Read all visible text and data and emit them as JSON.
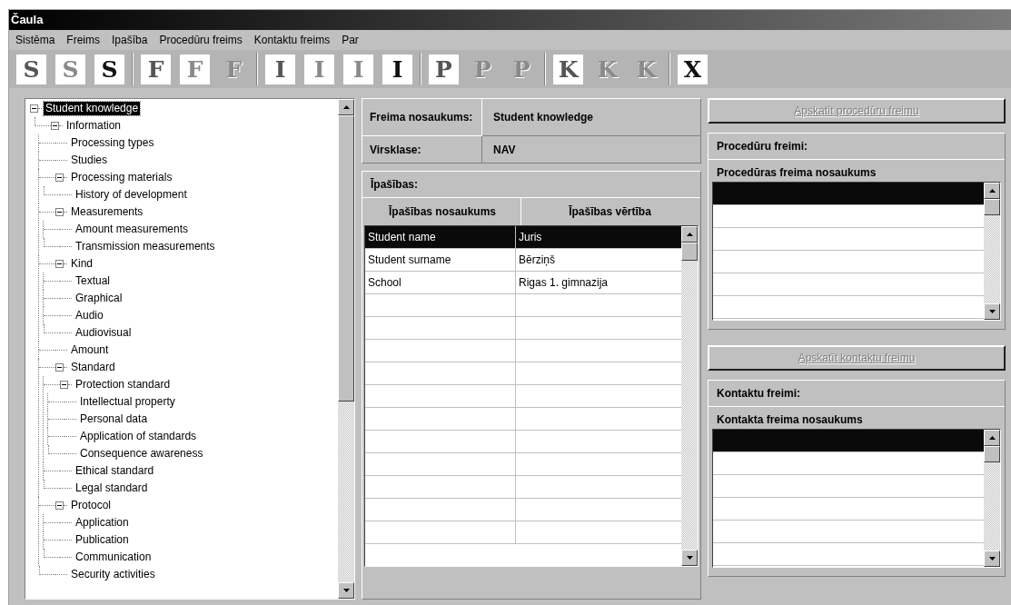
{
  "window": {
    "title": "Čaula"
  },
  "menu": [
    "Sistēma",
    "Freims",
    "Ipašība",
    "Procedūru freims",
    "Kontaktu freims",
    "Par"
  ],
  "toolbar": [
    [
      {
        "letter": "S",
        "kind": "dark"
      },
      {
        "letter": "S",
        "kind": "light"
      },
      {
        "letter": "S",
        "kind": "black"
      }
    ],
    [
      {
        "letter": "F",
        "kind": "dark"
      },
      {
        "letter": "F",
        "kind": "light"
      },
      {
        "letter": "F",
        "kind": "disabled"
      }
    ],
    [
      {
        "letter": "I",
        "kind": "dark"
      },
      {
        "letter": "I",
        "kind": "light"
      },
      {
        "letter": "I",
        "kind": "light"
      },
      {
        "letter": "I",
        "kind": "black"
      }
    ],
    [
      {
        "letter": "P",
        "kind": "dark"
      },
      {
        "letter": "P",
        "kind": "disabled"
      },
      {
        "letter": "P",
        "kind": "disabled"
      }
    ],
    [
      {
        "letter": "K",
        "kind": "dark"
      },
      {
        "letter": "K",
        "kind": "disabled"
      },
      {
        "letter": "K",
        "kind": "disabled"
      }
    ],
    [
      {
        "letter": "X",
        "kind": "black"
      }
    ]
  ],
  "tree": [
    {
      "label": "Student knowledge",
      "selected": true,
      "expanded": true,
      "children": [
        {
          "label": "Information",
          "selected": false,
          "expanded": true,
          "children": [
            {
              "label": "Processing types",
              "selected": false
            },
            {
              "label": "Studies",
              "selected": false
            },
            {
              "label": "Processing materials",
              "selected": false,
              "expanded": true,
              "children": [
                {
                  "label": "History of development",
                  "selected": false
                }
              ]
            },
            {
              "label": "Measurements",
              "selected": false,
              "expanded": true,
              "children": [
                {
                  "label": "Amount measurements",
                  "selected": false
                },
                {
                  "label": "Transmission measurements",
                  "selected": false
                }
              ]
            },
            {
              "label": "Kind",
              "selected": false,
              "expanded": true,
              "children": [
                {
                  "label": "Textual",
                  "selected": false
                },
                {
                  "label": "Graphical",
                  "selected": false
                },
                {
                  "label": "Audio",
                  "selected": false
                },
                {
                  "label": "Audiovisual",
                  "selected": false
                }
              ]
            },
            {
              "label": "Amount",
              "selected": false
            },
            {
              "label": "Standard",
              "selected": false,
              "expanded": true,
              "children": [
                {
                  "label": "Protection standard",
                  "selected": false,
                  "expanded": true,
                  "children": [
                    {
                      "label": "Intellectual property",
                      "selected": false
                    },
                    {
                      "label": "Personal data",
                      "selected": false
                    },
                    {
                      "label": "Application of standards",
                      "selected": false
                    },
                    {
                      "label": "Consequence awareness",
                      "selected": false
                    }
                  ]
                },
                {
                  "label": "Ethical standard",
                  "selected": false
                },
                {
                  "label": "Legal standard",
                  "selected": false
                }
              ]
            },
            {
              "label": "Protocol",
              "selected": false,
              "expanded": true,
              "children": [
                {
                  "label": "Application",
                  "selected": false
                },
                {
                  "label": "Publication",
                  "selected": false
                },
                {
                  "label": "Communication",
                  "selected": false
                }
              ]
            },
            {
              "label": "Security activities",
              "selected": false
            }
          ]
        }
      ]
    }
  ],
  "frame": {
    "name_label": "Freima nosaukums:",
    "name_value": "Student knowledge",
    "superclass_label": "Virsklase:",
    "superclass_value": "NAV"
  },
  "properties": {
    "title": "Īpašības:",
    "columns": [
      "Īpašības nosaukums",
      "Īpašības vērtība"
    ],
    "rows": [
      {
        "name": "Student name",
        "value": "Juris",
        "selected": true
      },
      {
        "name": "Student surname",
        "value": "Bērziņš",
        "selected": false
      },
      {
        "name": "School",
        "value": "Rigas 1. gimnazija",
        "selected": false
      }
    ]
  },
  "procedure_button": {
    "label": "Apskatīt procedūru freimu",
    "disabled": true
  },
  "procedure_frames": {
    "title": "Procedūru freimi:",
    "column": "Procedūras freima nosaukums",
    "rows": [
      {
        "selected": true
      },
      {
        "selected": false
      },
      {
        "selected": false
      },
      {
        "selected": false
      },
      {
        "selected": false
      },
      {
        "selected": false
      }
    ]
  },
  "contact_button": {
    "label": "Apskatīt kontaktu freimu",
    "disabled": true
  },
  "contact_frames": {
    "title": "Kontaktu freimi:",
    "column": "Kontakta freima nosaukums",
    "rows": [
      {
        "selected": true
      },
      {
        "selected": false
      },
      {
        "selected": false
      },
      {
        "selected": false
      },
      {
        "selected": false
      },
      {
        "selected": false
      }
    ]
  }
}
